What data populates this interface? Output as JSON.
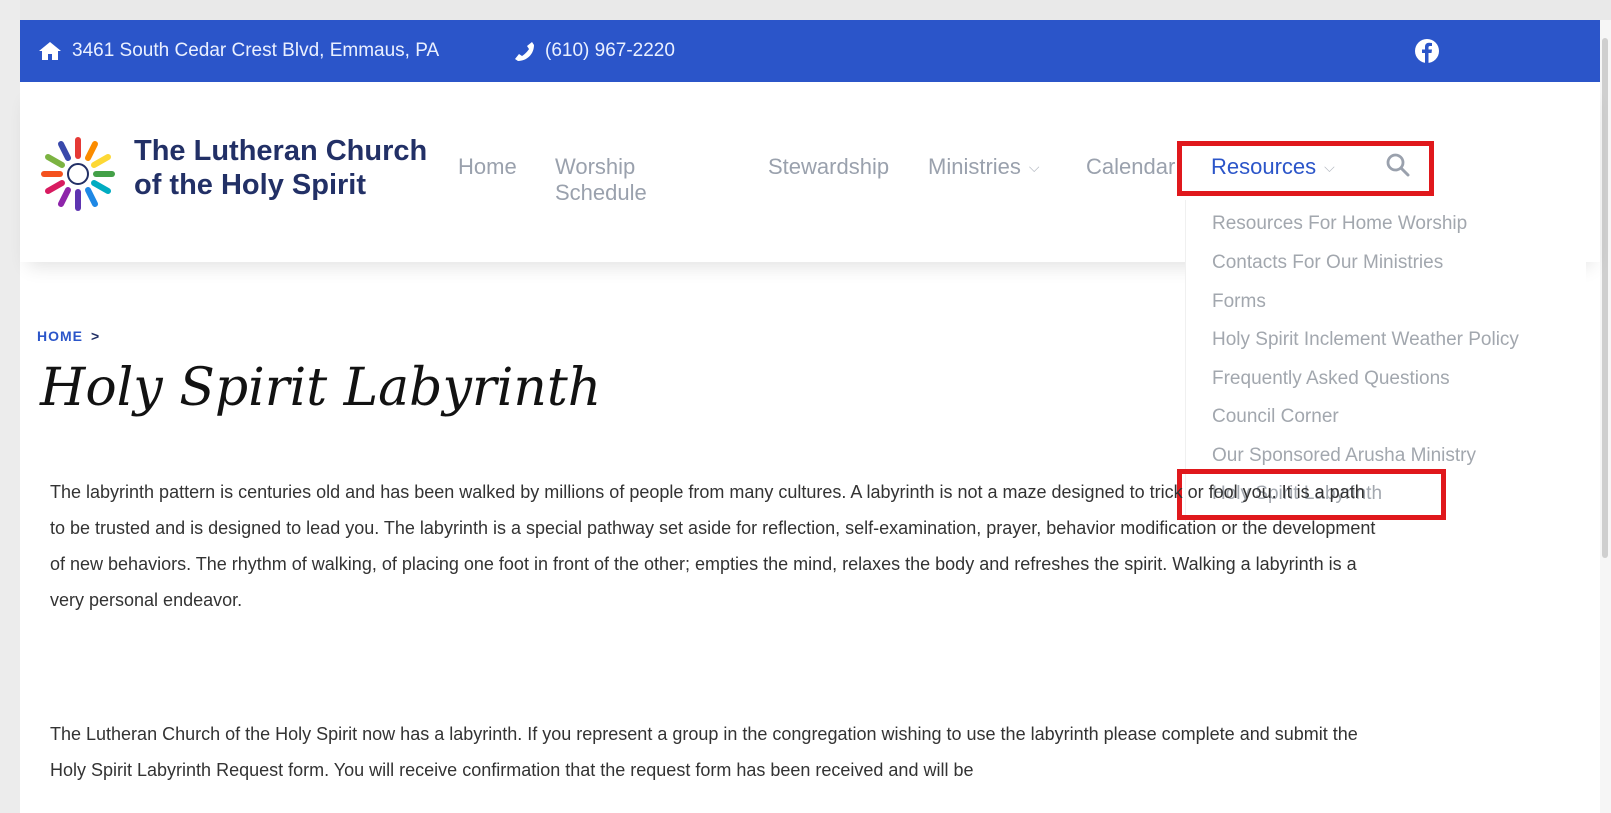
{
  "topbar": {
    "address": "3461 South Cedar Crest Blvd, Emmaus, PA",
    "phone": "(610) 967-2220",
    "icons": [
      "home-icon",
      "phone-icon",
      "facebook-icon"
    ]
  },
  "brand": {
    "line1": "The Lutheran Church",
    "line2": "of the Holy Spirit"
  },
  "nav": {
    "items": [
      {
        "label": "Home"
      },
      {
        "label": "Worship Schedule"
      },
      {
        "label": "Stewardship"
      },
      {
        "label": "Ministries"
      },
      {
        "label": "Calendar"
      },
      {
        "label": "Resources"
      }
    ],
    "chevron": "⌵"
  },
  "dropdown": {
    "items": [
      "Resources For Home Worship",
      "Contacts For Our Ministries",
      "Forms",
      "Holy Spirit Inclement Weather Policy",
      "Frequently Asked Questions",
      "Council Corner",
      "Our Sponsored Arusha Ministry",
      "Holy Spirit Labyrinth"
    ]
  },
  "breadcrumb": {
    "home": "HOME",
    "separator": ">"
  },
  "page": {
    "title": "Holy Spirit Labyrinth",
    "paragraph1": "The labyrinth pattern is centuries old and has been walked by millions of people from many cultures. A labyrinth is not a maze designed to trick or fool you. It is a path to be trusted and is designed to lead you. The labyrinth is a special pathway set aside for reflection, self-examination, prayer, behavior modification or the development of new behaviors. The rhythm of walking, of placing one foot in front of the other; empties the mind, relaxes the body and refreshes the spirit. Walking a labyrinth is a very personal endeavor.",
    "paragraph2": "The Lutheran Church of the Holy Spirit now has a labyrinth. If you represent a group in the congregation wishing to use the labyrinth please complete and submit the Holy Spirit Labyrinth Request form. You will receive confirmation that the request form has been received and will be"
  },
  "colors": {
    "accent": "#2b55c9",
    "highlight": "#e0181c",
    "brand_text": "#223066"
  }
}
